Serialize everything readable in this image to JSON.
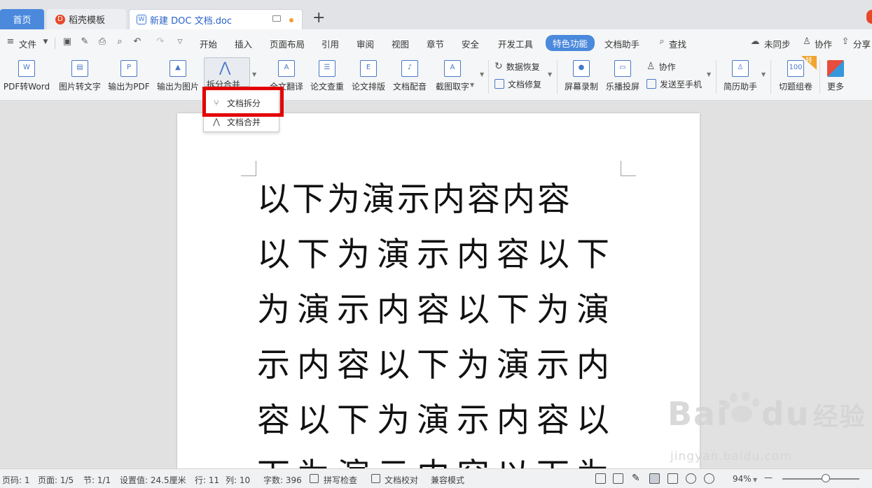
{
  "tabs": {
    "home": "首页",
    "template": "稻壳模板",
    "template_icon": "D",
    "doc": "新建 DOC 文档.doc",
    "doc_icon": "W",
    "new_tab": "+"
  },
  "menu": {
    "file": "文件",
    "items": [
      "开始",
      "插入",
      "页面布局",
      "引用",
      "审阅",
      "视图",
      "章节",
      "安全",
      "开发工具",
      "特色功能",
      "文档助手"
    ],
    "active": "特色功能",
    "find": "查找",
    "sync": "未同步",
    "collab": "协作",
    "share": "分享"
  },
  "ribbon": {
    "pdf_to_word": "PDF转Word",
    "img_to_text": "图片转文字",
    "export_pdf": "输出为PDF",
    "export_img": "输出为图片",
    "split_merge": "拆分合并",
    "translate": "全文翻译",
    "paper_check": "论文查重",
    "paper_layout": "论文排版",
    "dubbing": "文档配音",
    "screenshot_ocr": "截图取字",
    "data_recovery": "数据恢复",
    "doc_repair": "文档修复",
    "screen_record": "屏幕录制",
    "cast": "乐播投屏",
    "collab": "协作",
    "send_phone": "发送至手机",
    "resume": "简历助手",
    "quiz": "切题组卷",
    "special_badge": "特",
    "more": "更多"
  },
  "dropdown": {
    "split": "文档拆分",
    "merge": "文档合并"
  },
  "document": {
    "lines": [
      "以下为演示内容内容",
      "以下为演示内容以下",
      "为演示内容以下为演",
      "示内容以下为演示内",
      "容以下为演示内容以",
      "下为演示内容以下为"
    ]
  },
  "watermark": {
    "main": "Bai",
    "mid": "du",
    "cn": "经验",
    "url": "jingyan.baidu.com"
  },
  "status": {
    "page_num": "页码: 1",
    "page": "页面: 1/5",
    "section": "节: 1/1",
    "setting": "设置值: 24.5厘米",
    "row": "行: 11",
    "col": "列: 10",
    "words": "字数: 396",
    "spell": "拼写检查",
    "proof": "文档校对",
    "compat": "兼容模式",
    "zoom": "94%",
    "zoom_out": "—"
  }
}
